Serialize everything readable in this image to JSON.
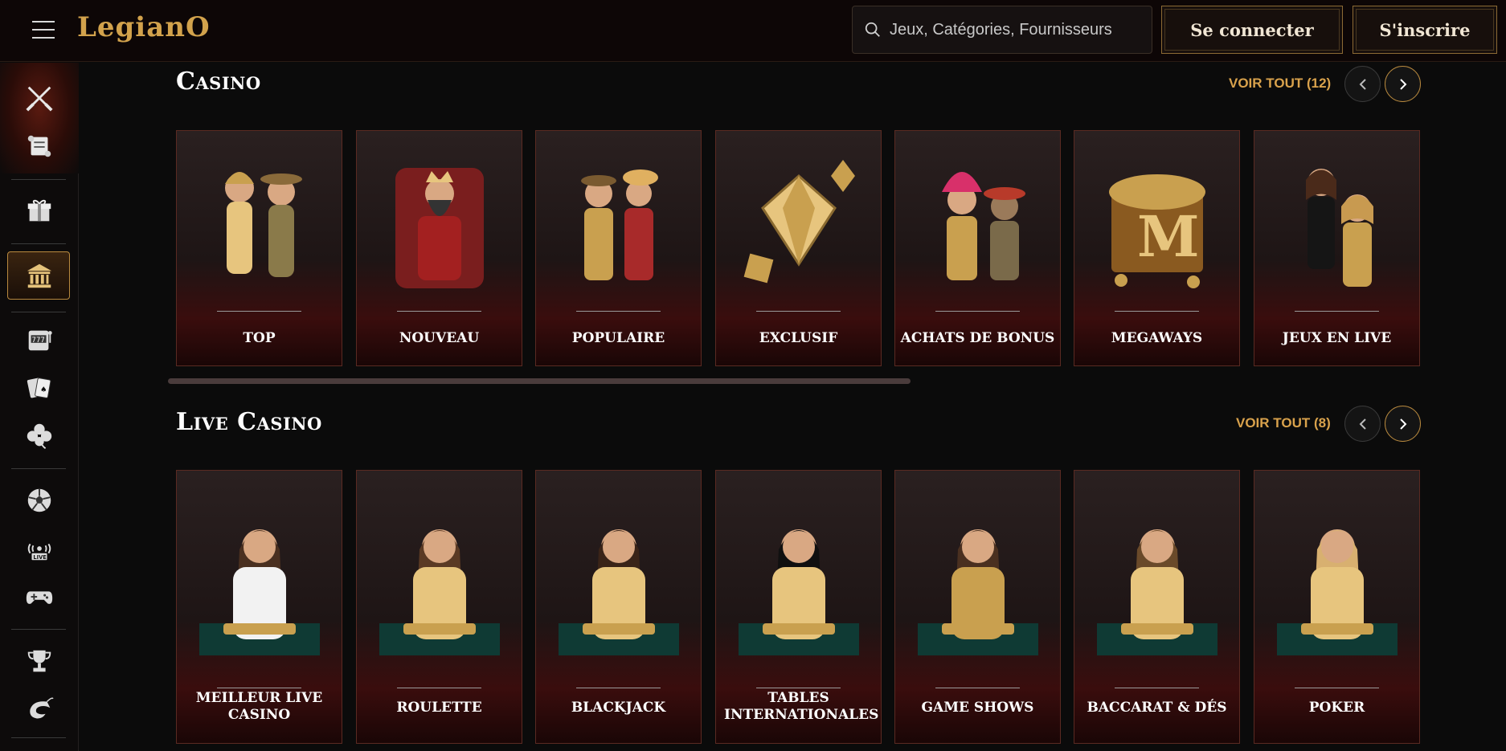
{
  "header": {
    "logo": "LegianO",
    "search_placeholder": "Jeux, Catégories, Fournisseurs",
    "login_label": "Se connecter",
    "register_label": "S'inscrire"
  },
  "sidebar": {
    "icons": [
      "swords-icon",
      "scroll-icon",
      "gift-icon",
      "casino-building-icon",
      "slot-machine-icon",
      "playing-cards-icon",
      "clover-icon",
      "soccer-ball-icon",
      "live-icon",
      "gamepad-icon",
      "trophy-icon",
      "shrimp-icon"
    ],
    "active": "casino-building-icon"
  },
  "sections": [
    {
      "title": "Casino",
      "see_all": "VOIR TOUT (12)",
      "cards": [
        {
          "label": "TOP"
        },
        {
          "label": "NOUVEAU"
        },
        {
          "label": "POPULAIRE"
        },
        {
          "label": "EXCLUSIF"
        },
        {
          "label": "ACHATS DE BONUS"
        },
        {
          "label": "MEGAWAYS"
        },
        {
          "label": "JEUX EN LIVE"
        }
      ]
    },
    {
      "title": "Live Casino",
      "see_all": "VOIR TOUT (8)",
      "cards": [
        {
          "label": "MEILLEUR LIVE CASINO"
        },
        {
          "label": "ROULETTE"
        },
        {
          "label": "BLACKJACK"
        },
        {
          "label": "TABLES INTERNATIONALES"
        },
        {
          "label": "GAME SHOWS"
        },
        {
          "label": "BACCARAT & DÉS"
        },
        {
          "label": "POKER"
        }
      ]
    }
  ],
  "colors": {
    "accent": "#d9a24c",
    "background": "#0b0b0b",
    "card_border": "#5a2a22"
  }
}
